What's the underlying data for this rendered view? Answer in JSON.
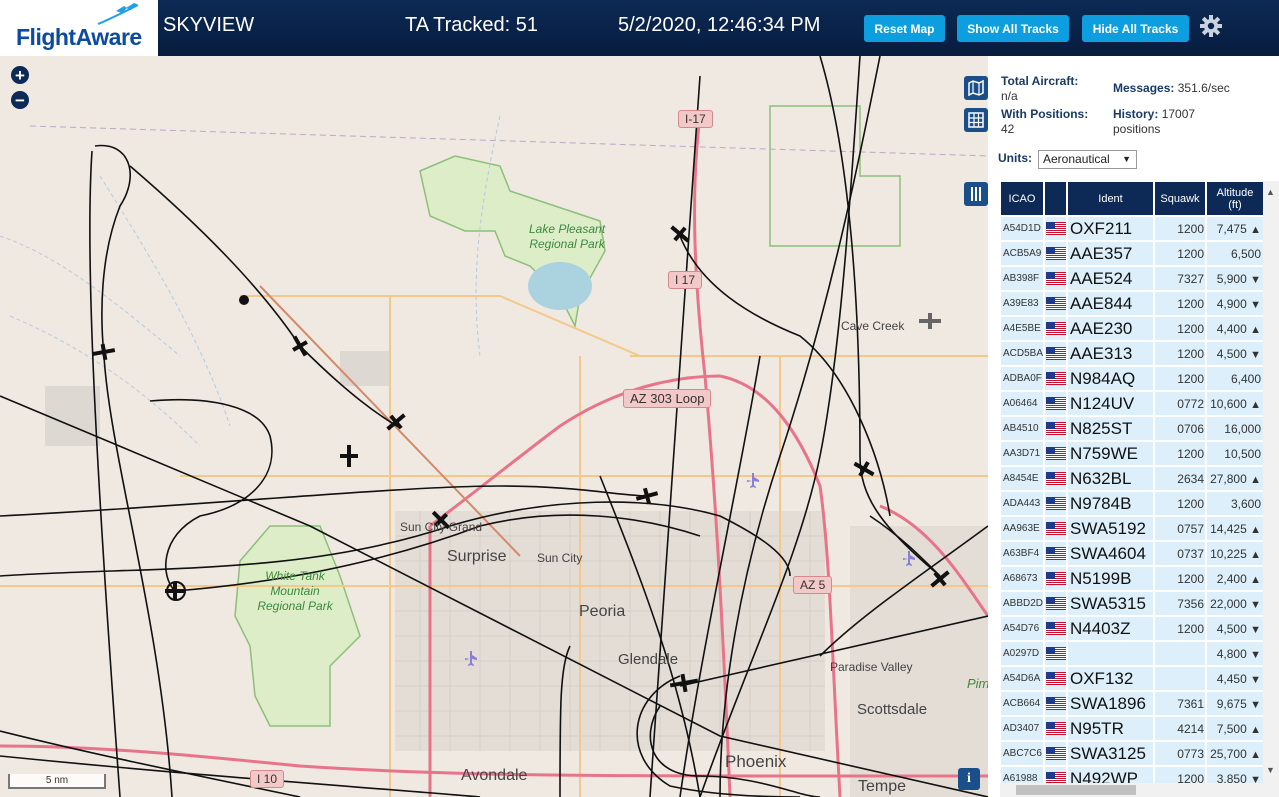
{
  "header": {
    "logo_text": "FlightAware",
    "app_name": "SKYVIEW",
    "tracked": "TA Tracked: 51",
    "datetime": "5/2/2020, 12:46:34 PM",
    "buttons": {
      "reset": "Reset Map",
      "show_all": "Show All Tracks",
      "hide_all": "Hide All Tracks"
    },
    "settings_icon": "gear-icon"
  },
  "map": {
    "zoom_in": "+",
    "zoom_out": "−",
    "scale": "5 nm",
    "info": "i",
    "places": {
      "lake_pleasant": "Lake Pleasant Regional Park",
      "white_tank": "White Tank Mountain Regional Park",
      "cave_creek": "Cave Creek",
      "sun_city_grand": "Sun City Grand",
      "surprise": "Surprise",
      "sun_city": "Sun City",
      "peoria": "Peoria",
      "glendale": "Glendale",
      "paradise_valley": "Paradise Valley",
      "scottsdale": "Scottsdale",
      "avondale": "Avondale",
      "phoenix": "Phoenix",
      "tempe": "Tempe",
      "pima_partial": "Pim"
    },
    "highways": {
      "i17_top": "I-17",
      "i17_mid": "I 17",
      "az303": "AZ 303 Loop",
      "az51": "AZ 5",
      "i10": "I 10"
    }
  },
  "stats": {
    "total_aircraft_label": "Total Aircraft:",
    "total_aircraft_value": "n/a",
    "messages_label": "Messages:",
    "messages_value": "351.6/sec",
    "with_positions_label": "With Positions:",
    "with_positions_value": "42",
    "history_label": "History:",
    "history_value": "17007",
    "history_unit": "positions"
  },
  "units": {
    "label": "Units:",
    "selected": "Aeronautical"
  },
  "table": {
    "columns": {
      "icao": "ICAO",
      "ident": "Ident",
      "squawk": "Squawk",
      "altitude": "Altitude (ft)"
    },
    "rows": [
      {
        "icao": "A54D1D",
        "ident": "OXF211",
        "squawk": "1200",
        "alt": "7,475",
        "trend": "▲"
      },
      {
        "icao": "ACB5A9",
        "ident": "AAE357",
        "squawk": "1200",
        "alt": "6,500",
        "trend": ""
      },
      {
        "icao": "AB398F",
        "ident": "AAE524",
        "squawk": "7327",
        "alt": "5,900",
        "trend": "▼"
      },
      {
        "icao": "A39E83",
        "ident": "AAE844",
        "squawk": "1200",
        "alt": "4,900",
        "trend": "▼"
      },
      {
        "icao": "A4E5BE",
        "ident": "AAE230",
        "squawk": "1200",
        "alt": "4,400",
        "trend": "▲"
      },
      {
        "icao": "ACD5BA",
        "ident": "AAE313",
        "squawk": "1200",
        "alt": "4,500",
        "trend": "▼"
      },
      {
        "icao": "ADBA0F",
        "ident": "N984AQ",
        "squawk": "1200",
        "alt": "6,400",
        "trend": ""
      },
      {
        "icao": "A06464",
        "ident": "N124UV",
        "squawk": "0772",
        "alt": "10,600",
        "trend": "▲"
      },
      {
        "icao": "AB4510",
        "ident": "N825ST",
        "squawk": "0706",
        "alt": "16,000",
        "trend": ""
      },
      {
        "icao": "AA3D71",
        "ident": "N759WE",
        "squawk": "1200",
        "alt": "10,500",
        "trend": ""
      },
      {
        "icao": "A8454E",
        "ident": "N632BL",
        "squawk": "2634",
        "alt": "27,800",
        "trend": "▲"
      },
      {
        "icao": "ADA443",
        "ident": "N9784B",
        "squawk": "1200",
        "alt": "3,600",
        "trend": ""
      },
      {
        "icao": "AA963E",
        "ident": "SWA5192",
        "squawk": "0757",
        "alt": "14,425",
        "trend": "▲"
      },
      {
        "icao": "A63BF4",
        "ident": "SWA4604",
        "squawk": "0737",
        "alt": "10,225",
        "trend": "▲"
      },
      {
        "icao": "A68673",
        "ident": "N5199B",
        "squawk": "1200",
        "alt": "2,400",
        "trend": "▲"
      },
      {
        "icao": "ABBD2D",
        "ident": "SWA5315",
        "squawk": "7356",
        "alt": "22,000",
        "trend": "▼"
      },
      {
        "icao": "A54D76",
        "ident": "N4403Z",
        "squawk": "1200",
        "alt": "4,500",
        "trend": "▼"
      },
      {
        "icao": "A0297D",
        "ident": "",
        "squawk": "",
        "alt": "4,800",
        "trend": "▼"
      },
      {
        "icao": "A54D6A",
        "ident": "OXF132",
        "squawk": "",
        "alt": "4,450",
        "trend": "▼"
      },
      {
        "icao": "ACB664",
        "ident": "SWA1896",
        "squawk": "7361",
        "alt": "9,675",
        "trend": "▼"
      },
      {
        "icao": "AD3407",
        "ident": "N95TR",
        "squawk": "4214",
        "alt": "7,500",
        "trend": "▲"
      },
      {
        "icao": "ABC7C6",
        "ident": "SWA3125",
        "squawk": "0773",
        "alt": "25,700",
        "trend": "▲"
      },
      {
        "icao": "A61988",
        "ident": "N492WP",
        "squawk": "1200",
        "alt": "3,850",
        "trend": "▼"
      }
    ]
  }
}
